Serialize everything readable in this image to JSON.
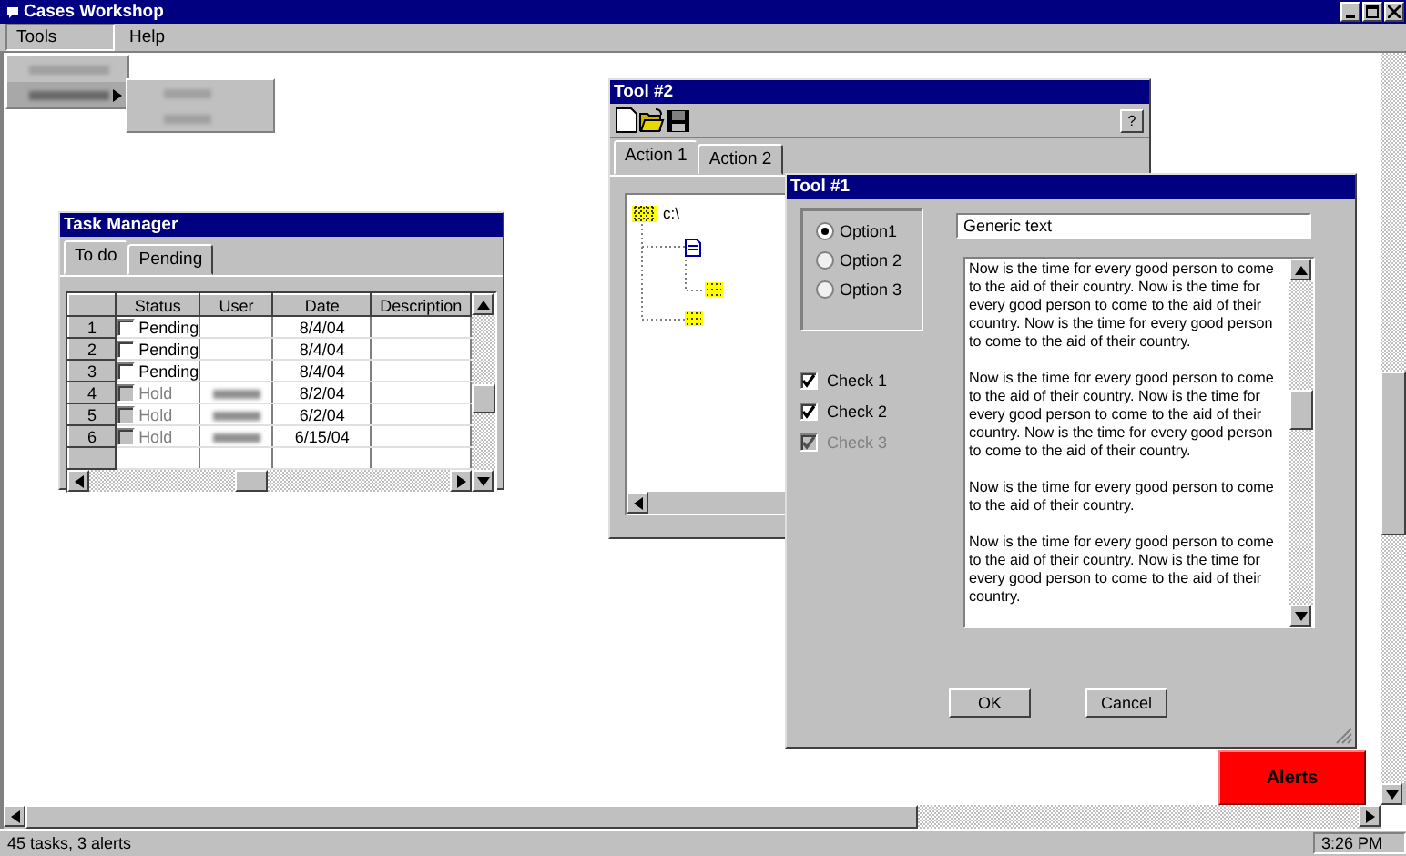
{
  "window": {
    "title": "Cases Workshop"
  },
  "menu_bar": [
    {
      "label": "Tools",
      "selected": true
    },
    {
      "label": "Help",
      "selected": false
    }
  ],
  "tools_menu": {
    "items": [
      {
        "kind": "plain"
      },
      {
        "kind": "submenu"
      }
    ],
    "submenu_items": [
      {
        "kind": "plain"
      },
      {
        "kind": "plain"
      }
    ]
  },
  "task_manager": {
    "title": "Task Manager",
    "tabs": [
      {
        "label": "To do",
        "selected": true
      },
      {
        "label": "Pending",
        "selected": false
      }
    ],
    "columns": [
      "Status",
      "User",
      "Date",
      "Description"
    ],
    "rows": [
      {
        "number": "1",
        "checked": false,
        "disabled": false,
        "status": "Pending",
        "user_blurred": false,
        "date": "8/4/04"
      },
      {
        "number": "2",
        "checked": false,
        "disabled": false,
        "status": "Pending",
        "user_blurred": false,
        "date": "8/4/04"
      },
      {
        "number": "3",
        "checked": false,
        "disabled": false,
        "status": "Pending",
        "user_blurred": false,
        "date": "8/4/04"
      },
      {
        "number": "4",
        "checked": false,
        "disabled": true,
        "status": "Hold",
        "user_blurred": true,
        "date": "8/2/04"
      },
      {
        "number": "5",
        "checked": false,
        "disabled": true,
        "status": "Hold",
        "user_blurred": true,
        "date": "6/2/04"
      },
      {
        "number": "6",
        "checked": false,
        "disabled": true,
        "status": "Hold",
        "user_blurred": true,
        "date": "6/15/04"
      }
    ]
  },
  "tool_2": {
    "title": "Tool #2",
    "help_button": "?",
    "tabs": [
      {
        "label": "Action 1",
        "selected": true
      },
      {
        "label": "Action 2",
        "selected": false
      }
    ],
    "tree": {
      "label": "c:\\",
      "kind": "folder",
      "children": [
        {
          "kind": "file",
          "children": [
            {
              "kind": "folder"
            }
          ]
        },
        {
          "kind": "folder"
        }
      ]
    }
  },
  "tool_1": {
    "title": "Tool #1",
    "options": [
      {
        "label": "Option1",
        "selected": true
      },
      {
        "label": "Option 2",
        "selected": false
      },
      {
        "label": "Option 3",
        "selected": false
      }
    ],
    "text_field": {
      "value": "Generic text"
    },
    "checks": [
      {
        "label": "Check 1",
        "checked": true,
        "disabled": false
      },
      {
        "label": "Check 2",
        "checked": true,
        "disabled": false
      },
      {
        "label": "Check 3",
        "checked": true,
        "disabled": true
      }
    ],
    "text_area": [
      "Now is the time for every good person to come to the aid of their country.  Now is the time for every good person to come to the aid of their country.  Now is the time for every good person to come to the aid of their country.",
      "Now is the time for every good person to come to the aid of their country.  Now is the time for every good person to come to the aid of their country.  Now is the time for every good person to come to the aid of their country.",
      "Now is the time for every good person to come to the aid of their country.",
      "Now is the time for every good person to come to the aid of their country.  Now is the time for every good person to come to the aid of their country."
    ],
    "buttons": [
      "OK",
      "Cancel"
    ]
  },
  "alerts_button": "Alerts",
  "status_bar": {
    "message": "45 tasks, 3 alerts",
    "time": "3:26 PM"
  }
}
